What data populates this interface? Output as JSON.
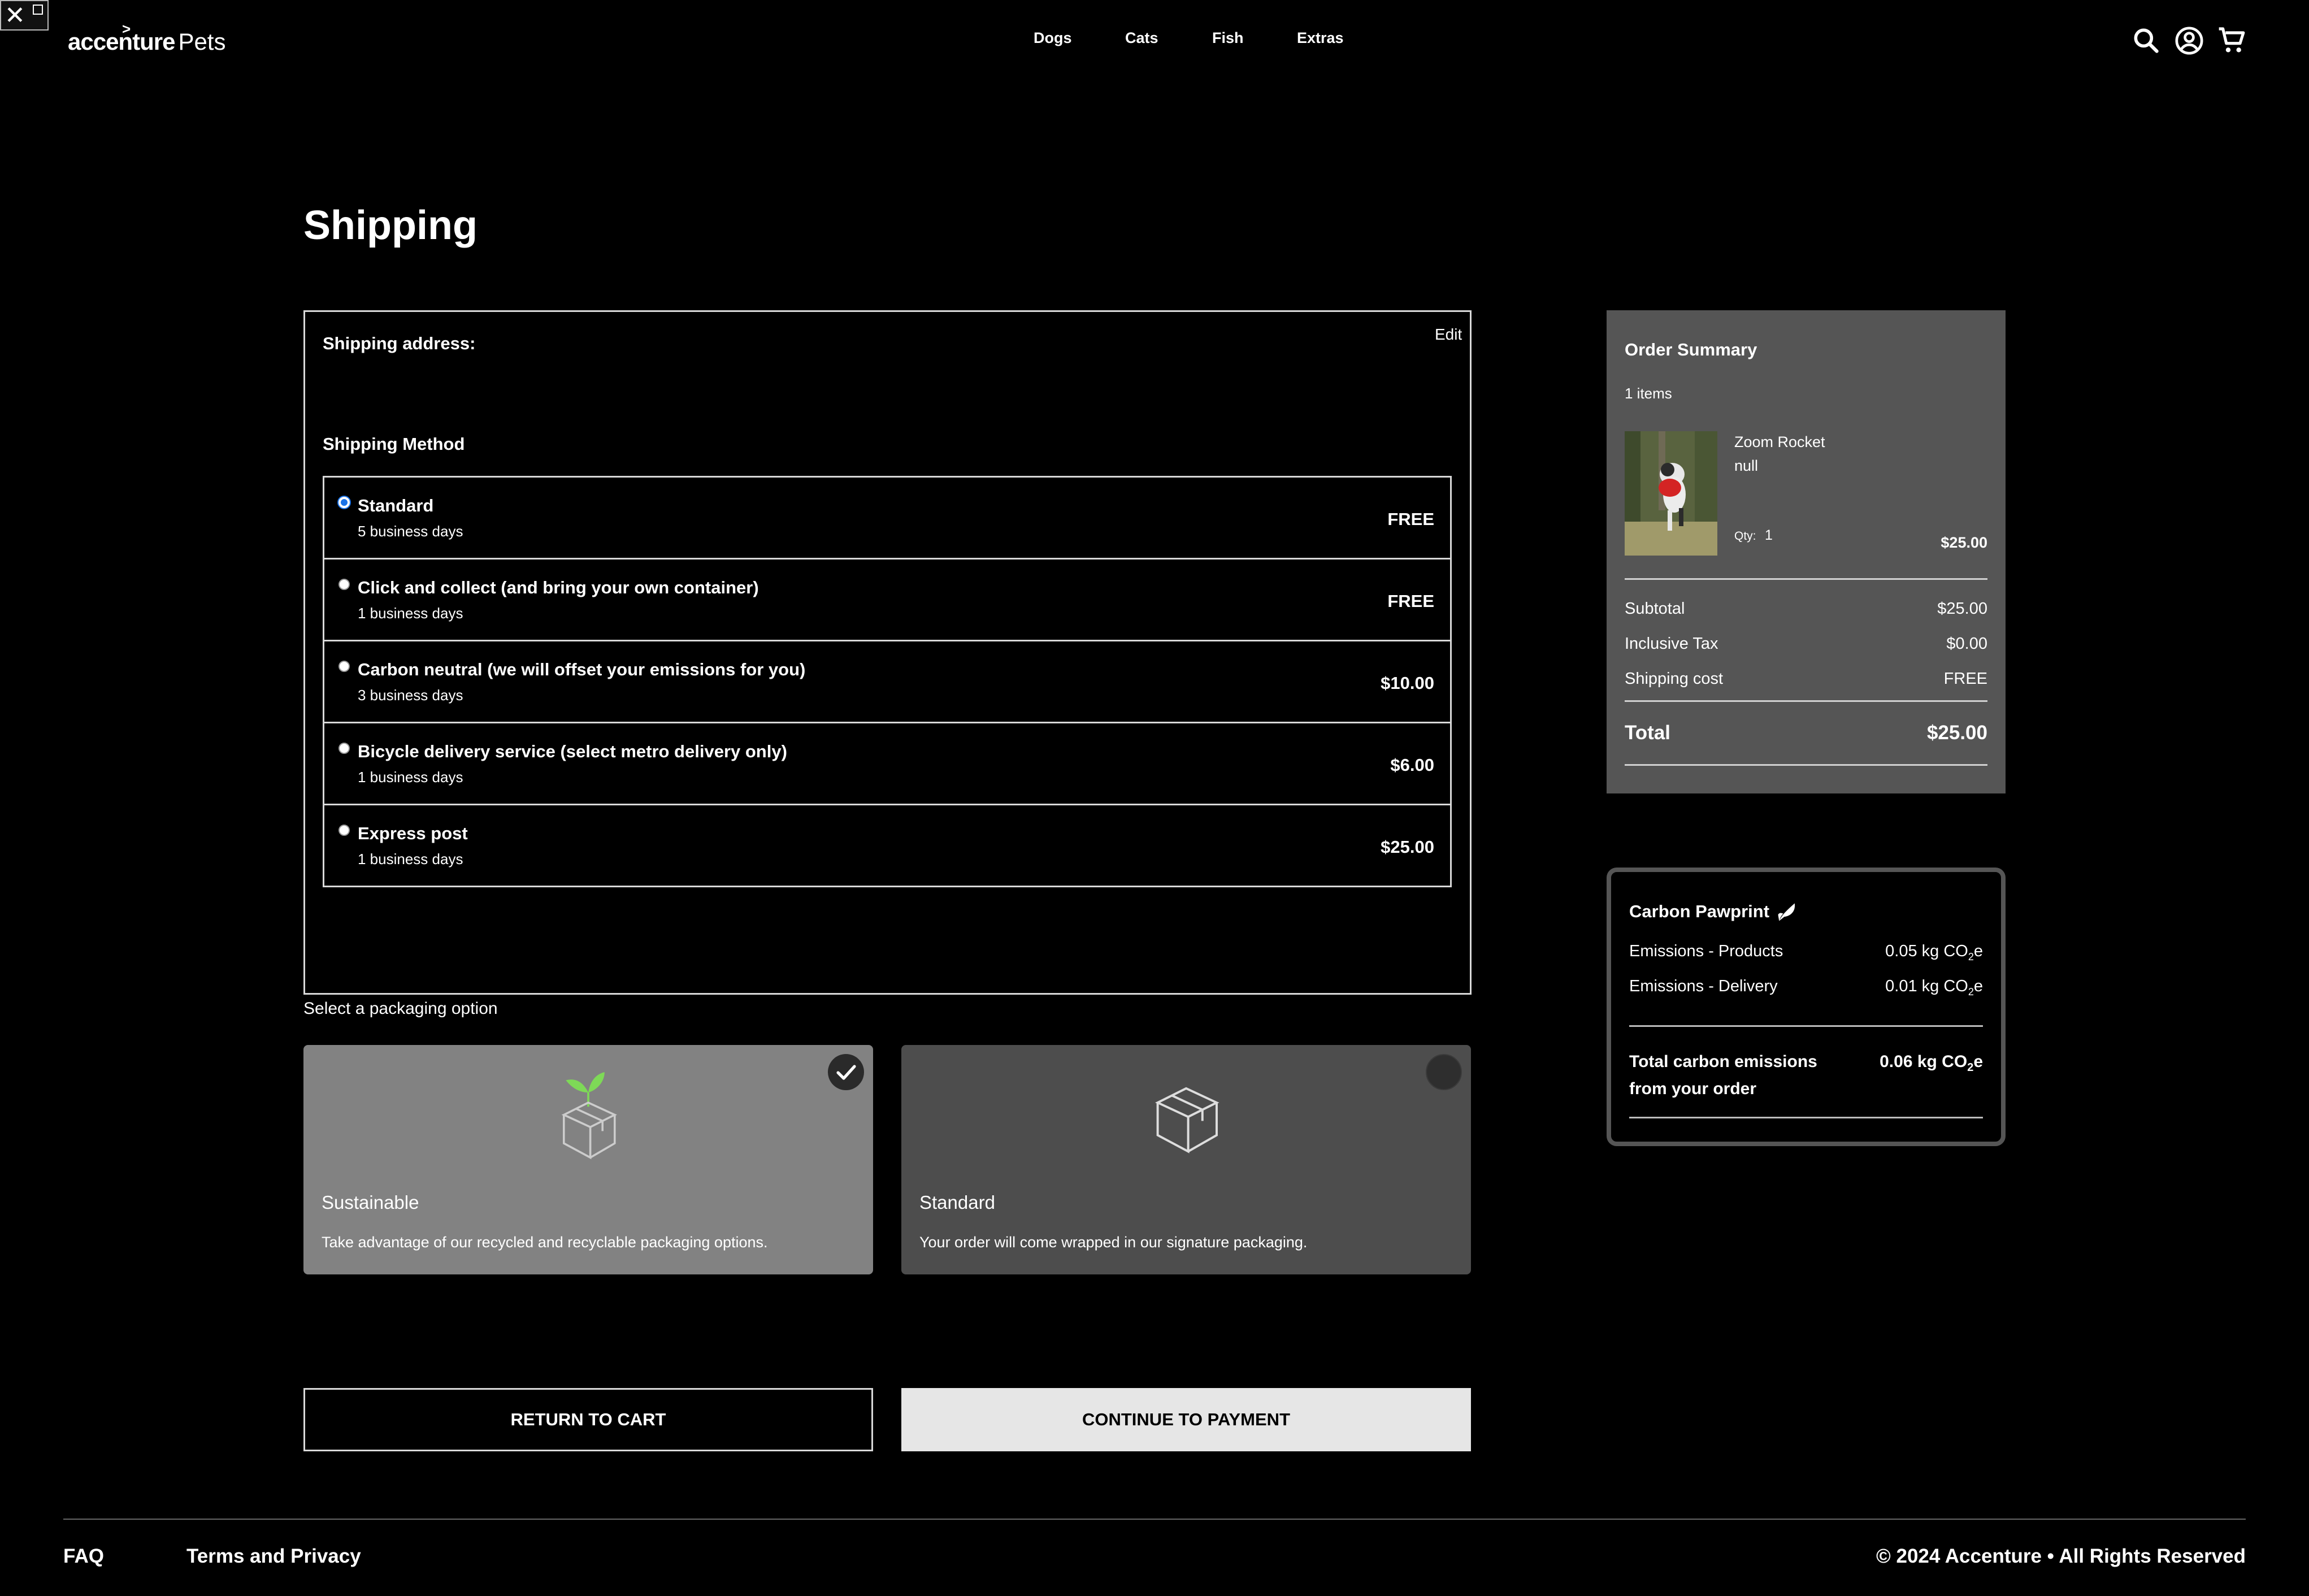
{
  "header": {
    "logo_brand": "accenture",
    "logo_suffix": "Pets",
    "nav": [
      "Dogs",
      "Cats",
      "Fish",
      "Extras"
    ],
    "icons": [
      "search-icon",
      "account-icon",
      "cart-icon"
    ]
  },
  "page": {
    "title": "Shipping"
  },
  "shipping": {
    "address_label": "Shipping address:",
    "edit_label": "Edit",
    "method_label": "Shipping Method",
    "selected_method": "Standard",
    "methods": [
      {
        "name": "Standard",
        "days": "5 business days",
        "price": "FREE"
      },
      {
        "name": "Click and collect (and bring your own container)",
        "days": "1 business days",
        "price": "FREE"
      },
      {
        "name": "Carbon neutral (we will offset your emissions for you)",
        "days": "3 business days",
        "price": "$10.00"
      },
      {
        "name": "Bicycle delivery service (select metro delivery only)",
        "days": "1 business days",
        "price": "$6.00"
      },
      {
        "name": "Express post",
        "days": "1 business days",
        "price": "$25.00"
      }
    ]
  },
  "packaging": {
    "label": "Select a packaging option",
    "selected": "Sustainable",
    "options": [
      {
        "title": "Sustainable",
        "description": "Take advantage of our recycled and recyclable packaging options.",
        "icon": "eco-box-icon"
      },
      {
        "title": "Standard",
        "description": "Your order will come wrapped in our signature packaging.",
        "icon": "box-icon"
      }
    ]
  },
  "buttons": {
    "return": "RETURN TO CART",
    "continue": "CONTINUE TO PAYMENT"
  },
  "order_summary": {
    "title": "Order Summary",
    "item_count": "1 items",
    "item": {
      "name": "Zoom Rocket",
      "variant": "null",
      "qty_label": "Qty:",
      "qty": "1",
      "price": "$25.00"
    },
    "subtotal_label": "Subtotal",
    "subtotal": "$25.00",
    "tax_label": "Inclusive Tax",
    "tax": "$0.00",
    "shipping_label": "Shipping cost",
    "shipping": "FREE",
    "total_label": "Total",
    "total": "$25.00"
  },
  "carbon": {
    "title": "Carbon Pawprint",
    "products_label": "Emissions - Products",
    "products_value": "0.05 kg CO",
    "delivery_label": "Emissions - Delivery",
    "delivery_value": "0.01 kg CO",
    "total_label": "Total carbon emissions from your order",
    "total_value": "0.06 kg CO",
    "subscript": "2",
    "suffix": "e"
  },
  "footer": {
    "faq": "FAQ",
    "terms": "Terms and Privacy",
    "copyright": "© 2024 Accenture • All Rights Reserved"
  },
  "colors": {
    "background": "#000000",
    "summary_panel": "#555555",
    "selected_pack": "#828282",
    "unselected_pack": "#4d4d4d",
    "continue_button": "#e6e6e6",
    "radio_selected": "#1a73e8",
    "leaf_green": "#7ed957"
  }
}
